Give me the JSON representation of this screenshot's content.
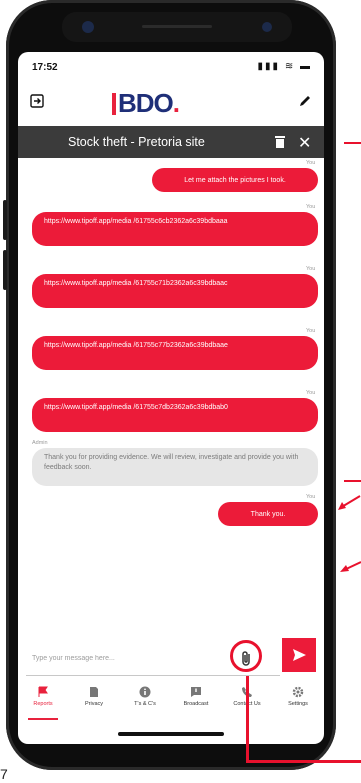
{
  "status": {
    "time": "17:52",
    "indicators": "▮▮▮ ≋ ▬"
  },
  "header": {
    "logo": "BDO",
    "logo_dot": "."
  },
  "conversation": {
    "title": "Stock theft - Pretoria site"
  },
  "messages": [
    {
      "sender": "You",
      "text": "Let me attach the pictures I took."
    },
    {
      "sender": "You",
      "text": "https://www.tipoff.app/media /61755c6cb2362a6c39bdbaaa"
    },
    {
      "sender": "You",
      "text": "https://www.tipoff.app/media /61755c71b2362a6c39bdbaac"
    },
    {
      "sender": "You",
      "text": "https://www.tipoff.app/media /61755c77b2362a6c39bdbaae"
    },
    {
      "sender": "You",
      "text": "https://www.tipoff.app/media /61755c7db2362a6c39bdbab0"
    },
    {
      "sender": "Admin",
      "text": "Thank you for providing evidence. We will review, investigate and provide you with feedback soon."
    },
    {
      "sender": "You",
      "text": "Thank you."
    }
  ],
  "composer": {
    "placeholder": "Type your message here..."
  },
  "nav": [
    {
      "label": "Reports",
      "icon": "flag-icon",
      "active": true
    },
    {
      "label": "Privacy",
      "icon": "document-icon"
    },
    {
      "label": "T's & C's",
      "icon": "info-icon"
    },
    {
      "label": "Broadcast",
      "icon": "broadcast-icon"
    },
    {
      "label": "Contact Us",
      "icon": "phone-icon"
    },
    {
      "label": "Settings",
      "icon": "gear-icon"
    }
  ],
  "colors": {
    "accent": "#ec1b39",
    "brand": "#1f2f78",
    "titlebar": "#3b3b3b",
    "annotation": "#e8112d"
  },
  "page_footer": "7"
}
